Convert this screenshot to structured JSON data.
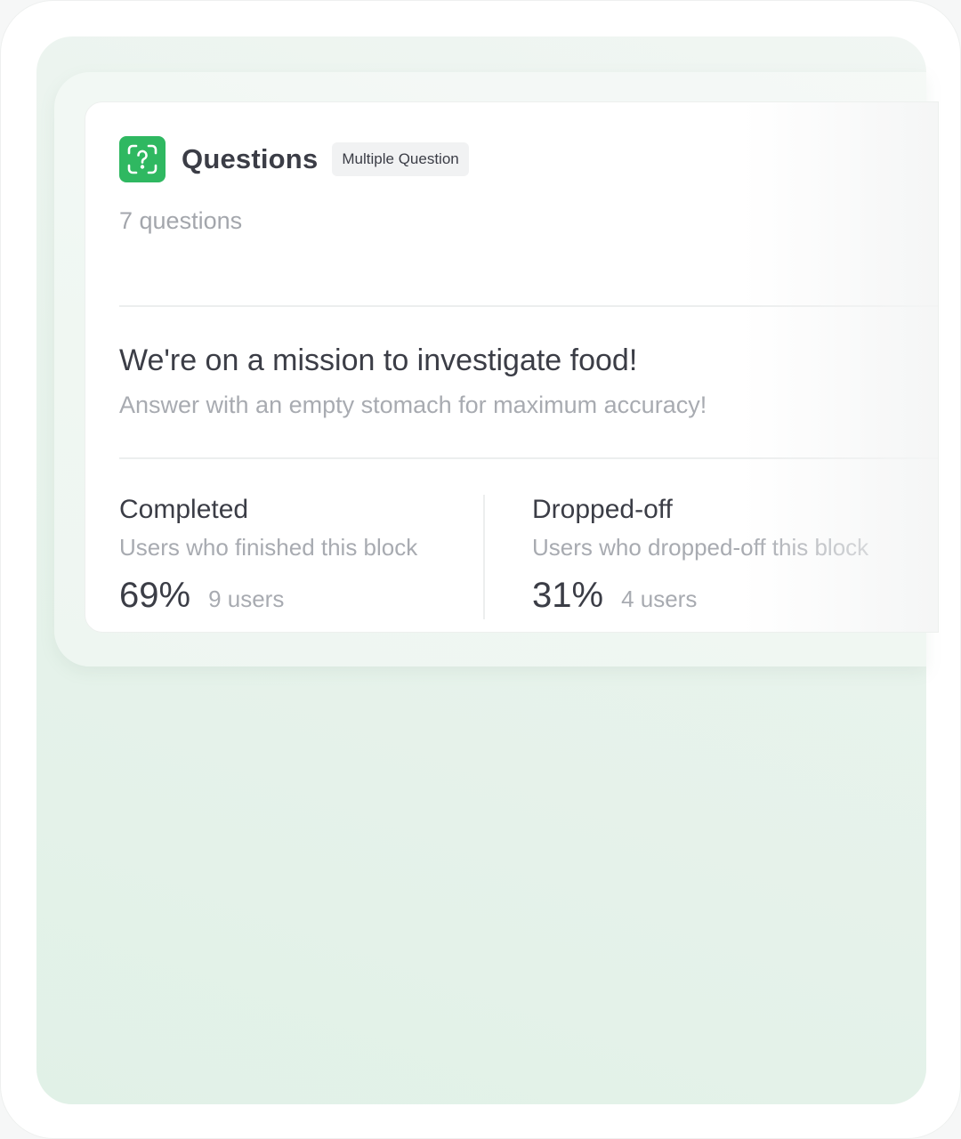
{
  "header": {
    "title": "Questions",
    "badge": "Multiple Question",
    "icon": "question-scan-icon",
    "icon_color": "#2fb861"
  },
  "question_count": "7 questions",
  "intro": {
    "title": "We're on a mission to investigate food!",
    "subtitle": "Answer with an empty stomach for maximum accuracy!"
  },
  "stats": [
    {
      "label": "Completed",
      "description": "Users who finished this block",
      "percent": "69%",
      "users": "9 users"
    },
    {
      "label": "Dropped-off",
      "description": "Users who dropped-off this block",
      "percent": "31%",
      "users": "4 users"
    }
  ],
  "colors": {
    "accent": "#2fb861",
    "background_green": "#e1f1e7",
    "text_primary": "#3b3d46",
    "text_muted": "#a8abb1"
  }
}
